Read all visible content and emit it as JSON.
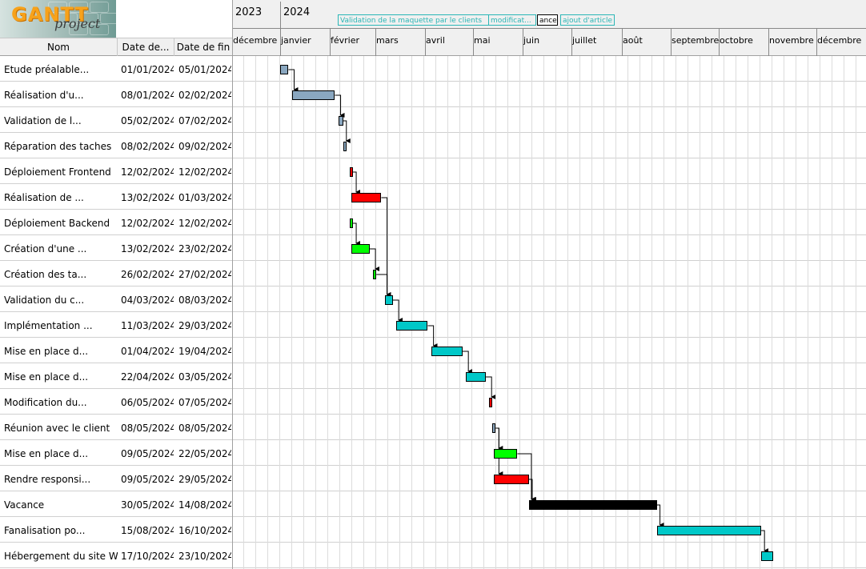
{
  "logo": {
    "gantt": "GANTT",
    "project": "project"
  },
  "table": {
    "headers": {
      "name": "Nom",
      "start": "Date de...",
      "end": "Date de fin"
    }
  },
  "timeline": {
    "years": [
      "2023",
      "2024"
    ],
    "months": [
      "décembre",
      "janvier",
      "février",
      "mars",
      "avril",
      "mai",
      "juin",
      "juillet",
      "août",
      "septembre",
      "octobre",
      "novembre",
      "décembre"
    ],
    "milestones": [
      "Validation de la maquette par le clients",
      "modificat...",
      "ance",
      "ajout d'article"
    ]
  },
  "colors": {
    "steel": "#8aa7c0",
    "red": "#ff0000",
    "green": "#00ff00",
    "cyan": "#00c8c8",
    "black": "#000000"
  },
  "tasks": [
    {
      "name": "Etude préalable...",
      "start": "01/01/2024",
      "end": "05/01/2024",
      "color": "steel"
    },
    {
      "name": "Réalisation d'u...",
      "start": "08/01/2024",
      "end": "02/02/2024",
      "color": "steel"
    },
    {
      "name": "Validation de l...",
      "start": "05/02/2024",
      "end": "07/02/2024",
      "color": "steel"
    },
    {
      "name": "Réparation des taches",
      "start": "08/02/2024",
      "end": "09/02/2024",
      "color": "steel"
    },
    {
      "name": "Déploiement Frontend",
      "start": "12/02/2024",
      "end": "12/02/2024",
      "color": "red"
    },
    {
      "name": "Réalisation de ...",
      "start": "13/02/2024",
      "end": "01/03/2024",
      "color": "red"
    },
    {
      "name": "Déploiement Backend",
      "start": "12/02/2024",
      "end": "12/02/2024",
      "color": "green"
    },
    {
      "name": "Création d'une ...",
      "start": "13/02/2024",
      "end": "23/02/2024",
      "color": "green"
    },
    {
      "name": "Création des ta...",
      "start": "26/02/2024",
      "end": "27/02/2024",
      "color": "green"
    },
    {
      "name": "Validation du c...",
      "start": "04/03/2024",
      "end": "08/03/2024",
      "color": "cyan"
    },
    {
      "name": "Implémentation ...",
      "start": "11/03/2024",
      "end": "29/03/2024",
      "color": "cyan"
    },
    {
      "name": "Mise en place d...",
      "start": "01/04/2024",
      "end": "19/04/2024",
      "color": "cyan"
    },
    {
      "name": "Mise en place d...",
      "start": "22/04/2024",
      "end": "03/05/2024",
      "color": "cyan"
    },
    {
      "name": "Modification du...",
      "start": "06/05/2024",
      "end": "07/05/2024",
      "color": "red"
    },
    {
      "name": "Réunion avec le client",
      "start": "08/05/2024",
      "end": "08/05/2024",
      "color": "steel"
    },
    {
      "name": "Mise en place d...",
      "start": "09/05/2024",
      "end": "22/05/2024",
      "color": "green"
    },
    {
      "name": "Rendre responsi...",
      "start": "09/05/2024",
      "end": "29/05/2024",
      "color": "red"
    },
    {
      "name": "Vacance",
      "start": "30/05/2024",
      "end": "14/08/2024",
      "color": "black"
    },
    {
      "name": "Fanalisation po...",
      "start": "15/08/2024",
      "end": "16/10/2024",
      "color": "cyan"
    },
    {
      "name": "Hébergement du site Web",
      "start": "17/10/2024",
      "end": "23/10/2024",
      "color": "cyan"
    }
  ],
  "dependencies": [
    [
      0,
      1
    ],
    [
      1,
      2
    ],
    [
      2,
      3
    ],
    [
      4,
      5
    ],
    [
      6,
      7
    ],
    [
      7,
      8
    ],
    [
      5,
      9
    ],
    [
      8,
      9
    ],
    [
      9,
      10
    ],
    [
      10,
      11
    ],
    [
      11,
      12
    ],
    [
      12,
      13
    ],
    [
      14,
      15
    ],
    [
      14,
      16
    ],
    [
      15,
      17
    ],
    [
      16,
      17
    ],
    [
      17,
      18
    ],
    [
      18,
      19
    ]
  ]
}
